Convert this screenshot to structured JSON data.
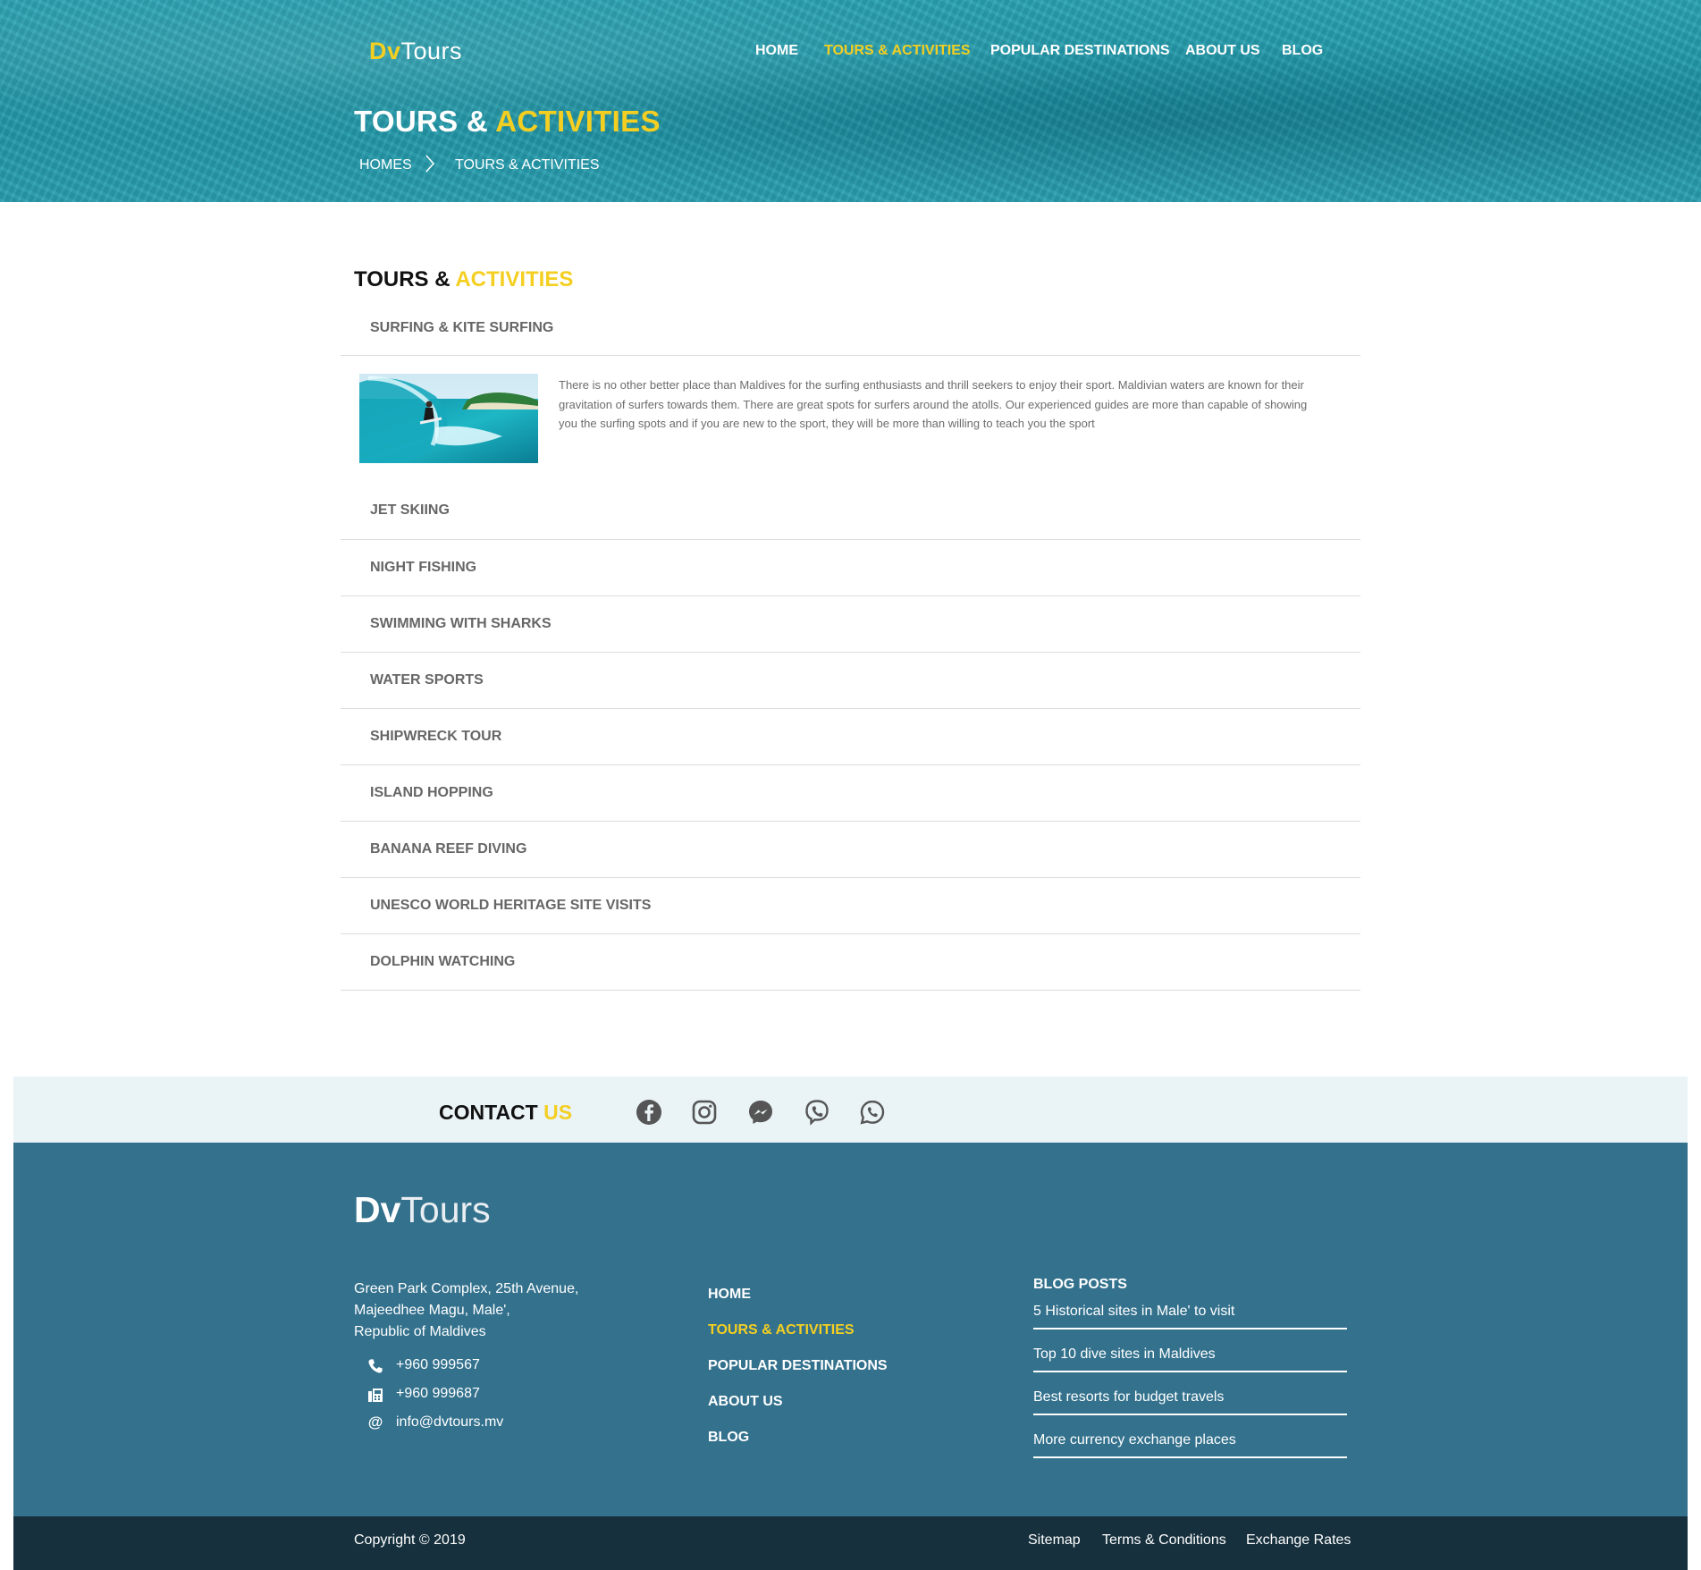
{
  "brand": {
    "prefix": "Dv",
    "suffix": "Tours"
  },
  "nav": {
    "home": "HOME",
    "tours": "TOURS & ACTIVITIES",
    "destinations": "POPULAR DESTINATIONS",
    "about": "ABOUT US",
    "blog": "BLOG"
  },
  "hero": {
    "title_a": "TOURS & ",
    "title_b": "ACTIVITIES",
    "crumb_home": "HOMES",
    "crumb_current": "TOURS & ACTIVITIES"
  },
  "section": {
    "title_a": "TOURS & ",
    "title_b": "ACTIVITIES"
  },
  "activities": [
    {
      "label": "SURFING & KITE SURFING",
      "expanded": true
    },
    {
      "label": "JET SKIING"
    },
    {
      "label": "NIGHT FISHING"
    },
    {
      "label": "SWIMMING WITH SHARKS"
    },
    {
      "label": "WATER SPORTS"
    },
    {
      "label": "SHIPWRECK TOUR"
    },
    {
      "label": "ISLAND HOPPING"
    },
    {
      "label": "BANANA REEF DIVING"
    },
    {
      "label": "UNESCO WORLD HERITAGE SITE VISITS"
    },
    {
      "label": "DOLPHIN WATCHING"
    }
  ],
  "surf_description": "There is no other better place than Maldives for the surfing enthusiasts and thrill seekers to enjoy their sport. Maldivian waters are known for their gravitation of surfers towards them. There are great spots for surfers around the atolls. Our experienced guides are more than capable of showing you the surfing spots and if you are new to the sport, they will be more than willing to teach you the sport",
  "contact": {
    "title_a": "CONTACT ",
    "title_b": "US",
    "socials": [
      "facebook-icon",
      "instagram-icon",
      "messenger-icon",
      "viber-icon",
      "whatsapp-icon"
    ]
  },
  "footer": {
    "logo_prefix": "Dv",
    "logo_suffix": "Tours",
    "address": [
      "Green Park Complex, 25th Avenue,",
      "Majeedhee Magu, Male',",
      "Republic of Maldives"
    ],
    "phone": "+960 999567",
    "fax": "+960 999687",
    "email": "info@dvtours.mv",
    "nav": [
      "HOME",
      "TOURS & ACTIVITIES",
      "POPULAR DESTINATIONS",
      "ABOUT US",
      "BLOG"
    ],
    "blog_title": "BLOG POSTS",
    "blog_posts": [
      "5 Historical sites in Male' to visit",
      "Top 10 dive sites in Maldives",
      "Best resorts for budget travels",
      "More currency exchange places"
    ],
    "copyright": "Copyright © 2019",
    "links": [
      "Sitemap",
      "Terms & Conditions",
      "Exchange Rates"
    ]
  },
  "colors": {
    "accent": "#f4cf22",
    "footer": "#33718d",
    "copyright_bar": "#16303d",
    "contact_bar": "#eaf3f6"
  }
}
